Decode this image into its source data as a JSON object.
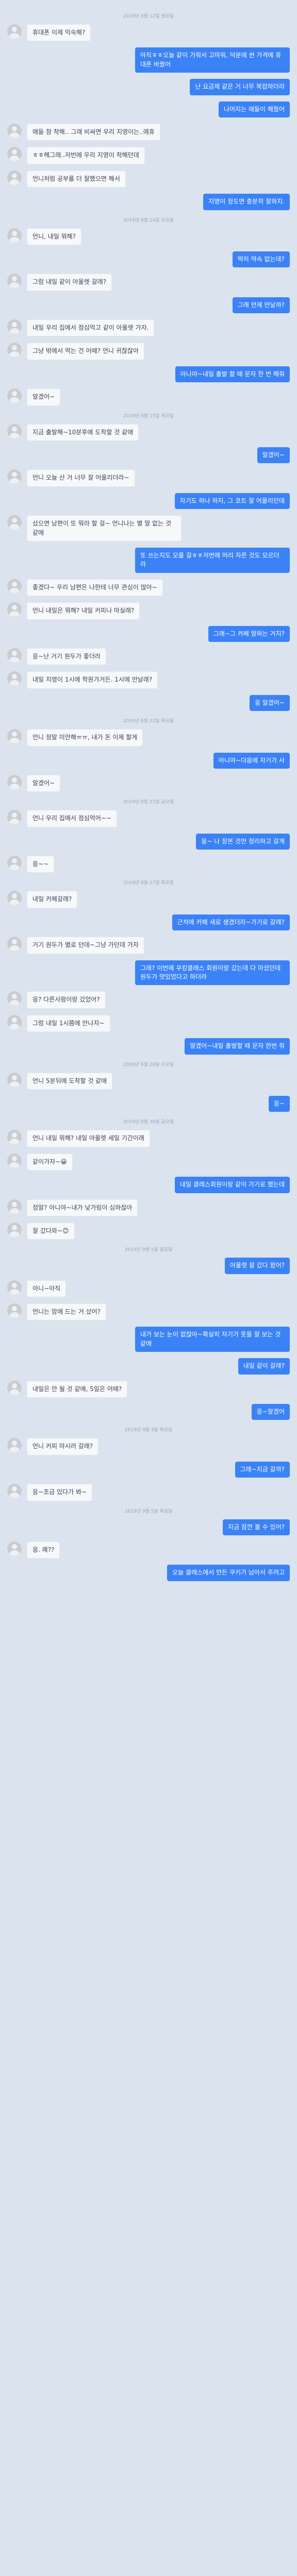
{
  "messages": [
    {
      "type": "date",
      "text": "2019년 8월 12일 월요일"
    },
    {
      "type": "them",
      "text": "휴대폰 이제 익숙해?"
    },
    {
      "type": "me",
      "text": "아직ㅎㅎ오늘 같이 가줘서 고마워, 덕분에 싼 가격에 휴대폰 바꿨어"
    },
    {
      "type": "me",
      "text": "난 요금제 같은 거 너무 복잡하더라"
    },
    {
      "type": "me",
      "text": "나머지는 애들이 해줬어"
    },
    {
      "type": "them",
      "text": "애들 참 착해.. 그래 비싸면 우리 지영이는..에휴"
    },
    {
      "type": "them",
      "text": "ㅎㅎ헤그래..저번에 우리 지영이 착해던데"
    },
    {
      "type": "them",
      "text": "언니처럼 공부를 더 잘했으면 해서"
    },
    {
      "type": "me",
      "text": "지영이 정도면 충분히 잘하지."
    },
    {
      "type": "date",
      "text": "2019년 8월 14일 수요일"
    },
    {
      "type": "them",
      "text": "언니, 내일 뭐해?"
    },
    {
      "type": "me",
      "text": "딱히 약속 없는데?"
    },
    {
      "type": "them",
      "text": "그럼 내일 같이 아울렛 갈래?"
    },
    {
      "type": "me",
      "text": "그래 언제 만날까?"
    },
    {
      "type": "them",
      "text": "내일 우리 집에서 점심먹고 같이 아울렛 가자."
    },
    {
      "type": "them",
      "text": "그냥 밖에서 먹는 건 어때? 언니 귀찮잖아"
    },
    {
      "type": "me",
      "text": "아니야~내일 출발 할 때 문자 한 번 해줘"
    },
    {
      "type": "them",
      "text": "알겠어~"
    },
    {
      "type": "date",
      "text": "2019년 8월 15일 목요일"
    },
    {
      "type": "them",
      "text": "지금 출발해~10분후에 도착할 것 같애"
    },
    {
      "type": "me",
      "text": "알겠어~"
    },
    {
      "type": "them",
      "text": "언니 오늘 산 거 너무 잘 어울리더라~"
    },
    {
      "type": "me",
      "text": "자기도 하나 하지, 그 코트 잘 어울리던데"
    },
    {
      "type": "them",
      "text": "샀으면 남편이 또 뭐라 할 걸~ 언니나는 별 말 없는 것 같애"
    },
    {
      "type": "me",
      "text": "또 쓰는지도 모를 걸ㅎㅎ저번에 머리 자른 것도 모르더라"
    },
    {
      "type": "them",
      "text": "좋겠다~ 우리 남편은 나한테 너무 관심이 많아~"
    },
    {
      "type": "them",
      "text": "언니 내일은 뭐해? 내일 커피나 마실래?"
    },
    {
      "type": "me",
      "text": "그래~그 카페 말하는 거지?"
    },
    {
      "type": "them",
      "text": "응~난 거기 원두가 좋더라"
    },
    {
      "type": "them",
      "text": "내일 지영이 1시에 학원가거든. 1시에 만날래?"
    },
    {
      "type": "me",
      "text": "응 알겠어~"
    },
    {
      "type": "date",
      "text": "2019년 8월 22일 목요일"
    },
    {
      "type": "them",
      "text": "언니 정말 미안해ㅠㅠ, 내가 돈 이제 할게"
    },
    {
      "type": "me",
      "text": "아니야~다음에 자기가 사"
    },
    {
      "type": "them",
      "text": "알겠어~"
    },
    {
      "type": "date",
      "text": "2019년 8월 23일 금요일"
    },
    {
      "type": "them",
      "text": "언니 우리 집에서 점심먹어~~"
    },
    {
      "type": "me",
      "text": "응~ 나 장본 것만 정리하고 갈게"
    },
    {
      "type": "them",
      "text": "응~~"
    },
    {
      "type": "date",
      "text": "2019년 8월 27일 화요일"
    },
    {
      "type": "them",
      "text": "내일 카페갈래?"
    },
    {
      "type": "me",
      "text": "근처에 카페 새로 생겼더라~가기로 갈래?"
    },
    {
      "type": "them",
      "text": "거기 원두가 별로 던데~그냥 가던데 가자"
    },
    {
      "type": "me",
      "text": "그래? 이번에 쿠킹클래스 회원이랑 갔는데 다 마셨던데 원두가 맛있었다고 하더라"
    },
    {
      "type": "them",
      "text": "응? 다른사람이랑 갔었어?"
    },
    {
      "type": "them",
      "text": "그럼 내일 1시쯤에 만나자~"
    },
    {
      "type": "me",
      "text": "알겠어~내일 출발할 때 문자 한번 줘"
    },
    {
      "type": "date",
      "text": "2019년 8월 28일 수요일"
    },
    {
      "type": "them",
      "text": "언니 5분뒤에 도착할 것 같애"
    },
    {
      "type": "me",
      "text": "응~"
    },
    {
      "type": "date",
      "text": "2019년 8월 30일 금요일"
    },
    {
      "type": "them",
      "text": "언니 내일 뭐해? 내일 아울렛 세일 기간이래"
    },
    {
      "type": "them",
      "text": "같이가자~😀"
    },
    {
      "type": "me",
      "text": "내일 클래스회원이랑 같이 가기로 했는데"
    },
    {
      "type": "them",
      "text": "정말? 아니야~내가 낮가림이 심하잖아"
    },
    {
      "type": "them",
      "text": "잘 갔다와~😊"
    },
    {
      "type": "date",
      "text": "2019년 9월 1일 일요일"
    },
    {
      "type": "me",
      "text": "아울렛 잘 갔다 왔어?"
    },
    {
      "type": "them",
      "text": "아니~아직"
    },
    {
      "type": "them",
      "text": "언니는 맘에 드는 거 샀어?"
    },
    {
      "type": "me",
      "text": "내가 보는 눈이 없잖아~확실히 자기가 옷을 잘 보는 것 같애"
    },
    {
      "type": "me",
      "text": "내일 같이 갈래?"
    },
    {
      "type": "them",
      "text": "내일은 안 될 것 같애, 5일은 어때?"
    },
    {
      "type": "me",
      "text": "응~알겠어"
    },
    {
      "type": "date",
      "text": "2019년 9월 3일 화요일"
    },
    {
      "type": "them",
      "text": "언니 커피 마시러 갈래?"
    },
    {
      "type": "me",
      "text": "그래~지금 갈까?"
    },
    {
      "type": "them",
      "text": "응~조금 있다가 봐~"
    },
    {
      "type": "date",
      "text": "2019년 9월 5일 목요일"
    },
    {
      "type": "me",
      "text": "지금 잠깐 볼 수 있어?"
    },
    {
      "type": "them",
      "text": "응. 왜??"
    },
    {
      "type": "me",
      "text": "오늘 클래스에서 만든 쿠키가 남아서 주려고"
    }
  ]
}
